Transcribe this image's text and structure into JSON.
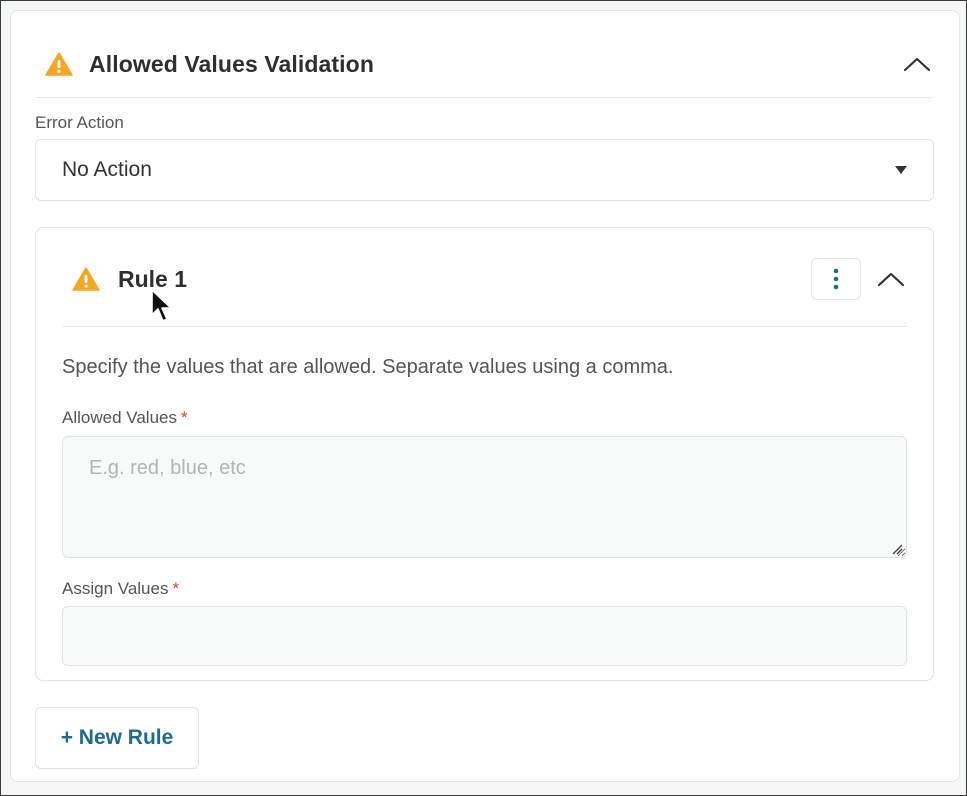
{
  "panel": {
    "title": "Allowed Values Validation",
    "error_action_label": "Error Action",
    "error_action_value": "No Action"
  },
  "rule": {
    "title": "Rule 1",
    "hint": "Specify the values that are allowed. Separate values using a comma.",
    "allowed_values_label": "Allowed Values",
    "allowed_values_placeholder": "E.g. red, blue, etc",
    "assign_values_label": "Assign Values",
    "required_mark": "*"
  },
  "actions": {
    "new_rule_label": "+ New Rule"
  },
  "icons": {
    "warning": "warning-icon",
    "collapse": "chevron-up-icon",
    "more": "kebab-icon",
    "dropdown": "caret-down-icon",
    "resize": "resize-grip-icon",
    "cursor": "mouse-cursor-icon"
  },
  "colors": {
    "warning": "#f5a623",
    "accent": "#1d6b8f",
    "required": "#d9472b"
  }
}
